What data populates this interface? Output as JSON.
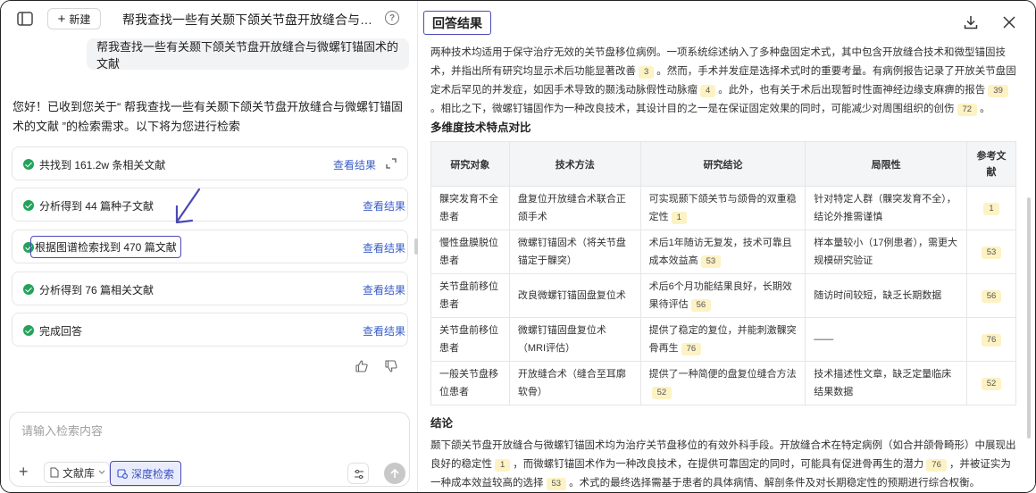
{
  "header": {
    "new_label": "新建",
    "conversation_title": "帮我查找一些有关颞下颌关节盘开放缝合与微螺钉…",
    "help_glyph": "?"
  },
  "chat": {
    "user_message": "帮我查找一些有关颞下颌关节盘开放缝合与微螺钉锚固术的文献",
    "assistant_intro": "您好！已收到您关于“ 帮我查找一些有关颞下颌关节盘开放缝合与微螺钉锚固术的文献 ”的检索需求。以下将为您进行检索",
    "steps": [
      {
        "label": "共找到 161.2w 条相关文献",
        "action": "查看结果"
      },
      {
        "label": "分析得到 44 篇种子文献",
        "action": "查看结果"
      },
      {
        "label": "根据图谱检索找到 470 篇文献",
        "action": "查看结果"
      },
      {
        "label": "分析得到 76 篇相关文献",
        "action": "查看结果"
      },
      {
        "label": "完成回答",
        "action": "查看结果"
      }
    ]
  },
  "input": {
    "placeholder": "请输入检索内容",
    "library_label": "文献库",
    "deep_search_label": "深度检索"
  },
  "result_panel": {
    "title": "回答结果",
    "para1": [
      "两种技术均适用于保守治疗无效的关节盘移位病例。一项系统综述纳入了多种盘固定术式，其中包含开放缝合技术和微型锚固技术，并指出所有研究均显示术后功能显著改善",
      "3",
      "。然而，手术并发症是选择术式时的重要考量。有病例报告记录了开放关节盘固定术后罕见的并发症，如因手术导致的颞浅动脉假性动脉瘤",
      "4",
      "。此外，也有关于术后出现暂时性面神经边缘支麻痹的报告",
      "39",
      "。相比之下，微螺钉锚固作为一种改良技术，其设计目的之一是在保证固定效果的同时，可能减少对周围组织的创伤",
      "72",
      "。"
    ],
    "table_heading": "多维度技术特点对比",
    "table_headers": [
      "研究对象",
      "技术方法",
      "研究结论",
      "局限性",
      "参考文献"
    ],
    "table_rows": [
      {
        "subject": "髁突发育不全患者",
        "method": "盘复位开放缝合术联合正颌手术",
        "conclusion": "可实现颞下颌关节与颌骨的双重稳定性",
        "limitation": "针对特定人群（髁突发育不全），结论外推需谨慎",
        "ref": "1"
      },
      {
        "subject": "慢性盘膜脱位患者",
        "method": "微螺钉锚固术（将关节盘锚定于髁突）",
        "conclusion": "术后1年随访无复发，技术可靠且成本效益高",
        "limitation": "样本量较小（17例患者），需更大规模研究验证",
        "ref": "53"
      },
      {
        "subject": "关节盘前移位患者",
        "method": "改良微螺钉锚固盘复位术",
        "conclusion": "术后6个月功能结果良好，长期效果待评估",
        "limitation": "随访时间较短，缺乏长期数据",
        "ref": "56"
      },
      {
        "subject": "关节盘前移位患者",
        "method": "微螺钉锚固盘复位术（MRI评估）",
        "conclusion": "提供了稳定的复位，并能刺激髁突骨再生",
        "limitation": "——",
        "ref": "76"
      },
      {
        "subject": "一般关节盘移位患者",
        "method": "开放缝合术（缝合至耳廓软骨）",
        "conclusion": "提供了一种简便的盘复位缝合方法",
        "limitation": "技术描述性文章，缺乏定量临床结果数据",
        "ref": "52"
      }
    ],
    "conclusion_heading": "结论",
    "conclusion": [
      "颞下颌关节盘开放缝合与微螺钉锚固术均为治疗关节盘移位的有效外科手段。开放缝合术在特定病例（如合并颌骨畸形）中展现出良好的稳定性",
      "1",
      "，而微螺钉锚固术作为一种改良技术，在提供可靠固定的同时，可能具有促进骨再生的潜力",
      "76",
      "，并被证实为一种成本效益较高的选择",
      "53",
      "。术式的最终选择需基于患者的具体病情、解剖条件及对长期稳定性的预期进行综合权衡。"
    ]
  },
  "colors": {
    "accent": "#4a4ab6",
    "link": "#3a5ec8",
    "success": "#22a35a",
    "ref_badge": "#fdf2c4"
  }
}
